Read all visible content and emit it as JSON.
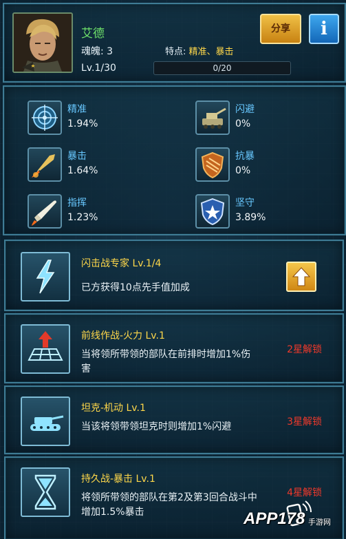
{
  "header": {
    "name": "艾德",
    "soul": "魂魄: 3",
    "trait_label": "特点: ",
    "trait_value": "精准、暴击",
    "level": "Lv.1/30",
    "exp_text": "0/20",
    "exp_progress": 0,
    "share_label": "分享",
    "info_label": "i"
  },
  "stats": [
    {
      "name": "精准",
      "value": "1.94%",
      "icon": "target-icon"
    },
    {
      "name": "闪避",
      "value": "0%",
      "icon": "artillery-icon"
    },
    {
      "name": "暴击",
      "value": "1.64%",
      "icon": "missile-icon"
    },
    {
      "name": "抗暴",
      "value": "0%",
      "icon": "shield-icon"
    },
    {
      "name": "指挥",
      "value": "1.23%",
      "icon": "rocket-icon"
    },
    {
      "name": "坚守",
      "value": "3.89%",
      "icon": "star-shield-icon"
    }
  ],
  "skills": [
    {
      "title": "闪击战专家 Lv.1/4",
      "desc": "已方获得10点先手值加成",
      "lock": "",
      "icon": "lightning-icon"
    },
    {
      "title": "前线作战-火力 Lv.1",
      "desc": "当将领所带领的部队在前排时增加1%伤害",
      "lock": "2星解锁",
      "icon": "grid-arrow-icon"
    },
    {
      "title": "坦克-机动 Lv.1",
      "desc": "当该将领带领坦克时则增加1%闪避",
      "lock": "3星解锁",
      "icon": "tank-icon"
    },
    {
      "title": "持久战-暴击 Lv.1",
      "desc": "将领所带领的部队在第2及第3回合战斗中增加1.5%暴击",
      "lock": "4星解锁",
      "icon": "hourglass-icon"
    }
  ],
  "watermark": {
    "text": "APP178",
    "sub": "手游网"
  },
  "colors": {
    "accent_green": "#6ee06a",
    "accent_yellow": "#ffd84a",
    "stat_blue": "#68c8ff",
    "lock_red": "#f0392b"
  }
}
